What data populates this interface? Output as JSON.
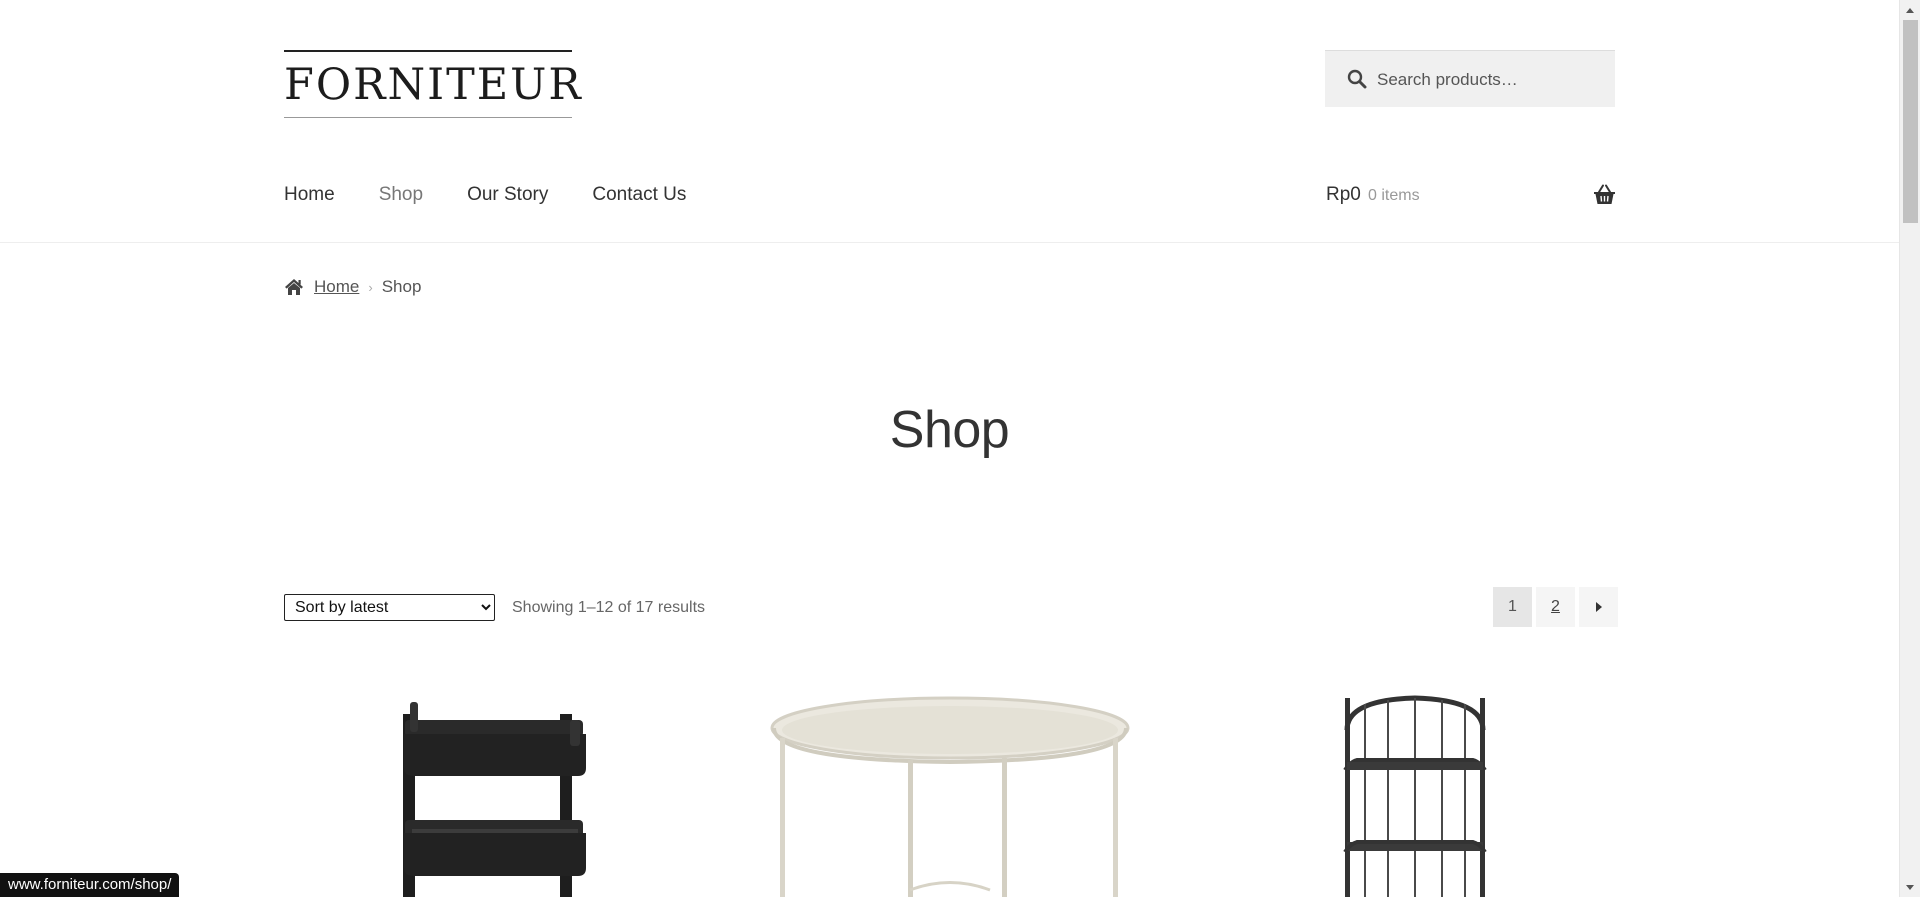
{
  "header": {
    "logo_text": "FORNITEUR",
    "search": {
      "placeholder": "Search products…",
      "icon": "search-icon"
    },
    "nav": [
      {
        "label": "Home",
        "active": false
      },
      {
        "label": "Shop",
        "active": true
      },
      {
        "label": "Our Story",
        "active": false
      },
      {
        "label": "Contact Us",
        "active": false
      }
    ],
    "cart": {
      "amount": "Rp0",
      "count": "0 items",
      "icon": "basket-icon"
    }
  },
  "breadcrumb": {
    "home_label": "Home",
    "separator": "›",
    "current": "Shop"
  },
  "page_title": "Shop",
  "toolbar": {
    "sort_selected": "Sort by latest",
    "result_count": "Showing 1–12 of 17 results",
    "pagination": {
      "pages": [
        "1",
        "2"
      ],
      "current": "1",
      "next_icon": "arrow-right-icon"
    }
  },
  "products": [
    {
      "image": "black-utility-cart"
    },
    {
      "image": "round-beige-side-table"
    },
    {
      "image": "black-metal-shelf"
    }
  ],
  "status_bar": {
    "url": "www.forniteur.com/shop/"
  },
  "colors": {
    "text": "#333333",
    "muted": "#777777",
    "search_bg": "#f0f0f0",
    "page_bg": "#ffffff"
  }
}
